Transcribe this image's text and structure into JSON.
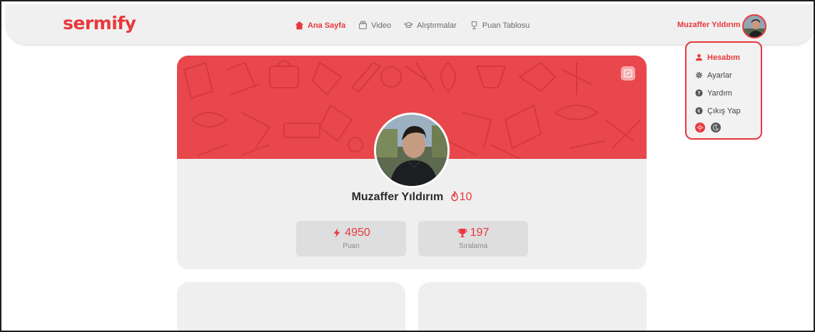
{
  "brand": {
    "logo_text": "sermify",
    "accent_color": "#e8383c"
  },
  "nav": {
    "items": [
      {
        "label": "Ana Sayfa",
        "icon": "home-icon",
        "active": true
      },
      {
        "label": "Video",
        "icon": "video-icon",
        "active": false
      },
      {
        "label": "Alıştırmalar",
        "icon": "graduation-cap-icon",
        "active": false
      },
      {
        "label": "Puan Tablosu",
        "icon": "trophy-icon",
        "active": false
      }
    ]
  },
  "user": {
    "name": "Muzaffer Yıldırım",
    "avatar_icon": "user-avatar"
  },
  "dropdown": {
    "items": [
      {
        "label": "Hesabım",
        "icon": "user-icon",
        "active": true
      },
      {
        "label": "Ayarlar",
        "icon": "gear-icon",
        "active": false
      },
      {
        "label": "Yardım",
        "icon": "question-icon",
        "active": false
      },
      {
        "label": "Çıkış Yap",
        "icon": "logout-icon",
        "active": false
      }
    ],
    "theme_options": [
      "sun-icon",
      "moon-icon"
    ]
  },
  "profile": {
    "name": "Muzaffer Yıldırım",
    "streak": "10",
    "stats": [
      {
        "value": "4950",
        "label": "Puan",
        "icon": "lightning-icon"
      },
      {
        "value": "197",
        "label": "Sıralama",
        "icon": "trophy-icon"
      }
    ],
    "banner_color": "#e8484b",
    "edit_icon": "edit-icon"
  }
}
